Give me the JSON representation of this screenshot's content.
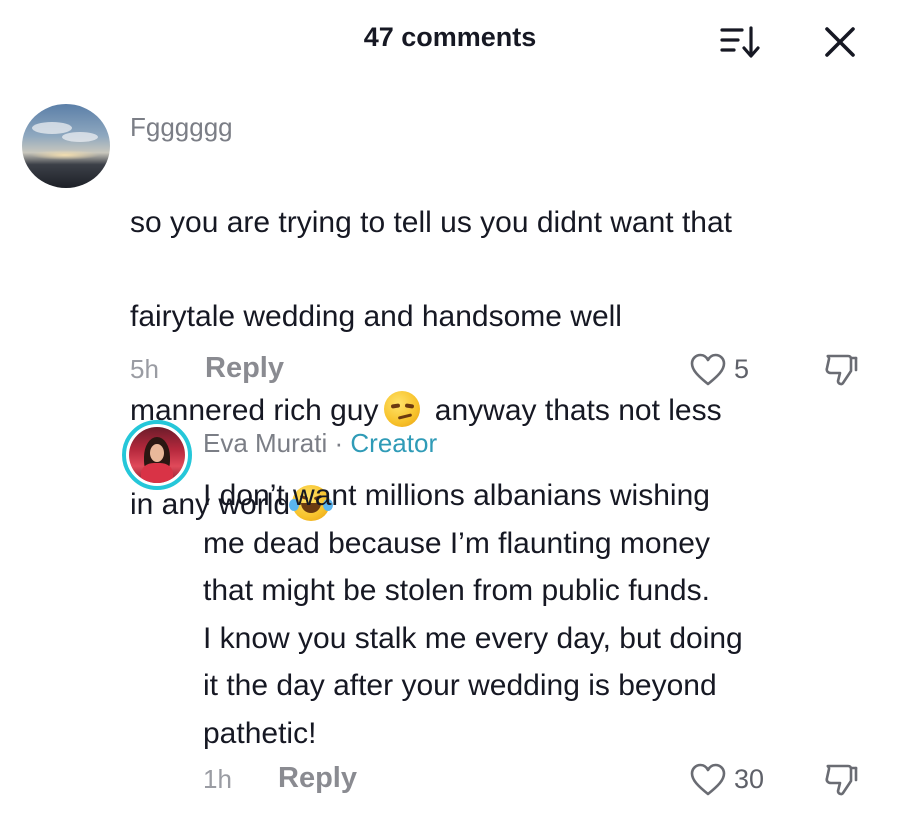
{
  "header": {
    "title": "47 comments",
    "sort_icon": "sort-icon",
    "close_icon": "close-icon"
  },
  "comment": {
    "username": "Fgggggg",
    "text_line1": "so you are trying to tell us you didnt want that",
    "text_line2": "fairytale wedding and handsome well",
    "text_line3_before": "mannered rich guy",
    "text_line3_after": " anyway thats not less",
    "text_line4": "in any world",
    "emoji_1": "smirk-emoji",
    "emoji_2": "joy-emoji",
    "time": "5h",
    "reply_label": "Reply",
    "likes": "5"
  },
  "reply": {
    "username": "Eva Murati",
    "separator": "·",
    "badge": "Creator",
    "text": "I don’t want millions albanians wishing\nme dead because I’m flaunting money\nthat might be stolen from public funds.\nI know you stalk me every day, but doing\nit the day after your wedding is beyond\npathetic!",
    "time": "1h",
    "reply_label": "Reply",
    "likes": "30"
  },
  "colors": {
    "text": "#161823",
    "muted": "#7b7e86",
    "creator": "#2f9bb7",
    "avatar_ring": "#25c7d9"
  }
}
